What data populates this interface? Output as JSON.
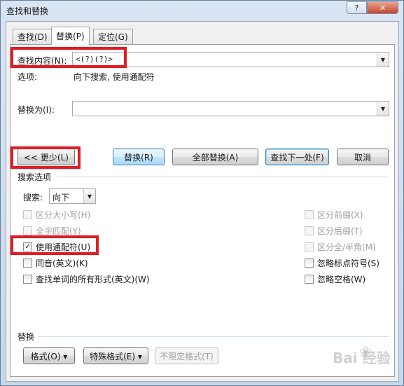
{
  "window": {
    "title": "查找和替换",
    "help_label": "?",
    "close_label": "✕"
  },
  "tabs": [
    {
      "label": "查找(D)"
    },
    {
      "label": "替换(P)"
    },
    {
      "label": "定位(G)"
    }
  ],
  "find": {
    "label": "查找内容(N):",
    "value": "<(?)(?)>",
    "options_label": "选项:",
    "options_value": "向下搜索, 使用通配符"
  },
  "replace": {
    "label": "替换为(I):",
    "value": ""
  },
  "buttons": {
    "less": "<< 更少(L)",
    "replace": "替换(R)",
    "replace_all": "全部替换(A)",
    "find_next": "查找下一处(F)",
    "cancel": "取消"
  },
  "search_options": {
    "title": "搜索选项",
    "search_label": "搜索:",
    "search_value": "向下",
    "left": [
      {
        "label": "区分大小写(H)",
        "checked": false,
        "disabled": true
      },
      {
        "label": "全字匹配(Y)",
        "checked": false,
        "disabled": true
      },
      {
        "label": "使用通配符(U)",
        "checked": true,
        "disabled": false
      },
      {
        "label": "同音(英文)(K)",
        "checked": false,
        "disabled": false
      },
      {
        "label": "查找单词的所有形式(英文)(W)",
        "checked": false,
        "disabled": false
      }
    ],
    "right": [
      {
        "label": "区分前缀(X)",
        "checked": false,
        "disabled": true
      },
      {
        "label": "区分后缀(T)",
        "checked": false,
        "disabled": true
      },
      {
        "label": "区分全/半角(M)",
        "checked": false,
        "disabled": true
      },
      {
        "label": "忽略标点符号(S)",
        "checked": false,
        "disabled": false
      },
      {
        "label": "忽略空格(W)",
        "checked": false,
        "disabled": false
      }
    ]
  },
  "replace_section": {
    "title": "替换",
    "format_button": "格式(O) ▾",
    "special_button": "特殊格式(E) ▾",
    "no_format_button": "不限定格式(T)"
  },
  "watermark": {
    "text": "Bai 经验",
    "icon": "paw-icon"
  },
  "colors": {
    "highlight": "#e31b23",
    "accent_blue": "#3c7fb1"
  }
}
